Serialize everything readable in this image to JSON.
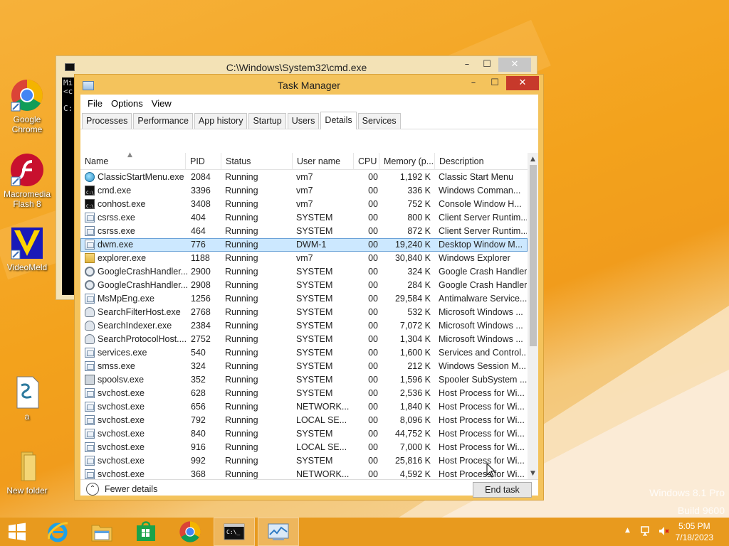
{
  "desktop": {
    "icons": [
      {
        "label": "Google Chrome",
        "icon": "chrome-icon"
      },
      {
        "label": "Macromedia Flash 8",
        "icon": "flash-icon"
      },
      {
        "label": "VideoMeld",
        "icon": "videomeld-icon"
      },
      {
        "label": "a",
        "icon": "script-file-icon"
      },
      {
        "label": "New folder",
        "icon": "folder-icon"
      }
    ],
    "watermark_line1": "Windows 8.1 Pro",
    "watermark_line2": "Build 9600"
  },
  "cmd_window": {
    "title": "C:\\Windows\\System32\\cmd.exe",
    "body_lines": [
      "Mi",
      "<c",
      "",
      "C:"
    ]
  },
  "task_manager": {
    "title": "Task Manager",
    "menu": [
      "File",
      "Options",
      "View"
    ],
    "tabs": [
      "Processes",
      "Performance",
      "App history",
      "Startup",
      "Users",
      "Details",
      "Services"
    ],
    "active_tab": "Details",
    "columns": [
      "Name",
      "PID",
      "Status",
      "User name",
      "CPU",
      "Memory (p...",
      "Description"
    ],
    "rows": [
      {
        "icon": "round",
        "name": "ClassicStartMenu.exe",
        "pid": "2084",
        "status": "Running",
        "user": "vm7",
        "cpu": "00",
        "mem": "1,192 K",
        "desc": "Classic Start Menu"
      },
      {
        "icon": "cmd",
        "name": "cmd.exe",
        "pid": "3396",
        "status": "Running",
        "user": "vm7",
        "cpu": "00",
        "mem": "336 K",
        "desc": "Windows Comman..."
      },
      {
        "icon": "cmd",
        "name": "conhost.exe",
        "pid": "3408",
        "status": "Running",
        "user": "vm7",
        "cpu": "00",
        "mem": "752 K",
        "desc": "Console Window H..."
      },
      {
        "icon": "gen",
        "name": "csrss.exe",
        "pid": "404",
        "status": "Running",
        "user": "SYSTEM",
        "cpu": "00",
        "mem": "800 K",
        "desc": "Client Server Runtim..."
      },
      {
        "icon": "gen",
        "name": "csrss.exe",
        "pid": "464",
        "status": "Running",
        "user": "SYSTEM",
        "cpu": "00",
        "mem": "872 K",
        "desc": "Client Server Runtim..."
      },
      {
        "icon": "gen",
        "name": "dwm.exe",
        "pid": "776",
        "status": "Running",
        "user": "DWM-1",
        "cpu": "00",
        "mem": "19,240 K",
        "desc": "Desktop Window M...",
        "selected": true
      },
      {
        "icon": "folder",
        "name": "explorer.exe",
        "pid": "1188",
        "status": "Running",
        "user": "vm7",
        "cpu": "00",
        "mem": "30,840 K",
        "desc": "Windows Explorer"
      },
      {
        "icon": "gear",
        "name": "GoogleCrashHandler...",
        "pid": "2900",
        "status": "Running",
        "user": "SYSTEM",
        "cpu": "00",
        "mem": "324 K",
        "desc": "Google Crash Handler"
      },
      {
        "icon": "gear",
        "name": "GoogleCrashHandler...",
        "pid": "2908",
        "status": "Running",
        "user": "SYSTEM",
        "cpu": "00",
        "mem": "284 K",
        "desc": "Google Crash Handler"
      },
      {
        "icon": "gen",
        "name": "MsMpEng.exe",
        "pid": "1256",
        "status": "Running",
        "user": "SYSTEM",
        "cpu": "00",
        "mem": "29,584 K",
        "desc": "Antimalware Service..."
      },
      {
        "icon": "person",
        "name": "SearchFilterHost.exe",
        "pid": "2768",
        "status": "Running",
        "user": "SYSTEM",
        "cpu": "00",
        "mem": "532 K",
        "desc": "Microsoft Windows ..."
      },
      {
        "icon": "person",
        "name": "SearchIndexer.exe",
        "pid": "2384",
        "status": "Running",
        "user": "SYSTEM",
        "cpu": "00",
        "mem": "7,072 K",
        "desc": "Microsoft Windows ..."
      },
      {
        "icon": "person",
        "name": "SearchProtocolHost....",
        "pid": "2752",
        "status": "Running",
        "user": "SYSTEM",
        "cpu": "00",
        "mem": "1,304 K",
        "desc": "Microsoft Windows ..."
      },
      {
        "icon": "gen",
        "name": "services.exe",
        "pid": "540",
        "status": "Running",
        "user": "SYSTEM",
        "cpu": "00",
        "mem": "1,600 K",
        "desc": "Services and Control..."
      },
      {
        "icon": "gen",
        "name": "smss.exe",
        "pid": "324",
        "status": "Running",
        "user": "SYSTEM",
        "cpu": "00",
        "mem": "212 K",
        "desc": "Windows Session M..."
      },
      {
        "icon": "printer",
        "name": "spoolsv.exe",
        "pid": "352",
        "status": "Running",
        "user": "SYSTEM",
        "cpu": "00",
        "mem": "1,596 K",
        "desc": "Spooler SubSystem ..."
      },
      {
        "icon": "gen",
        "name": "svchost.exe",
        "pid": "628",
        "status": "Running",
        "user": "SYSTEM",
        "cpu": "00",
        "mem": "2,536 K",
        "desc": "Host Process for Wi..."
      },
      {
        "icon": "gen",
        "name": "svchost.exe",
        "pid": "656",
        "status": "Running",
        "user": "NETWORK...",
        "cpu": "00",
        "mem": "1,840 K",
        "desc": "Host Process for Wi..."
      },
      {
        "icon": "gen",
        "name": "svchost.exe",
        "pid": "792",
        "status": "Running",
        "user": "LOCAL SE...",
        "cpu": "00",
        "mem": "8,096 K",
        "desc": "Host Process for Wi..."
      },
      {
        "icon": "gen",
        "name": "svchost.exe",
        "pid": "840",
        "status": "Running",
        "user": "SYSTEM",
        "cpu": "00",
        "mem": "44,752 K",
        "desc": "Host Process for Wi..."
      },
      {
        "icon": "gen",
        "name": "svchost.exe",
        "pid": "916",
        "status": "Running",
        "user": "LOCAL SE...",
        "cpu": "00",
        "mem": "7,000 K",
        "desc": "Host Process for Wi..."
      },
      {
        "icon": "gen",
        "name": "svchost.exe",
        "pid": "992",
        "status": "Running",
        "user": "SYSTEM",
        "cpu": "00",
        "mem": "25,816 K",
        "desc": "Host Process for Wi..."
      },
      {
        "icon": "gen",
        "name": "svchost.exe",
        "pid": "368",
        "status": "Running",
        "user": "NETWORK...",
        "cpu": "00",
        "mem": "4,592 K",
        "desc": "Host Process for Wi..."
      }
    ],
    "fewer_details_label": "Fewer details",
    "end_task_label": "End task"
  },
  "taskbar": {
    "items": [
      "start-icon",
      "internet-explorer-icon",
      "file-explorer-icon",
      "store-icon",
      "chrome-icon",
      "cmd-icon",
      "task-manager-icon"
    ],
    "clock_time": "5:05 PM",
    "clock_date": "7/18/2023"
  },
  "colors": {
    "wallpaper": "#f3a21c",
    "taskbar": "#e89a1e",
    "selection": "#cce8ff",
    "close_red": "#c7392b"
  }
}
